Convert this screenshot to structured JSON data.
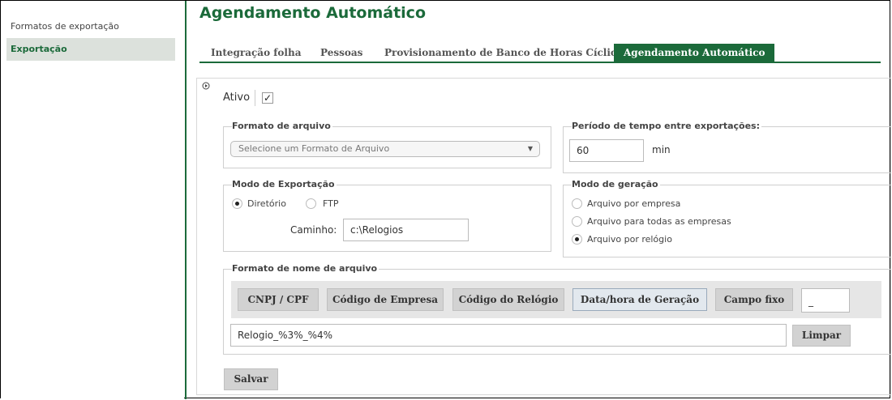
{
  "sidebar": {
    "items": [
      {
        "label": "Formatos de exportação"
      },
      {
        "label": "Exportação"
      }
    ]
  },
  "page": {
    "title": "Agendamento Automático"
  },
  "tabs": [
    {
      "label": "Integração folha"
    },
    {
      "label": "Pessoas"
    },
    {
      "label": "Provisionamento de Banco de Horas Cíclico"
    },
    {
      "label": "Agendamento Automático"
    }
  ],
  "form": {
    "ativo_label": "Ativo",
    "ativo_checked_glyph": "✓",
    "formato_arquivo": {
      "legend": "Formato de arquivo",
      "select_placeholder": "Selecione um Formato de Arquivo"
    },
    "periodo": {
      "legend": "Período de tempo entre exportações:",
      "value": "60",
      "unit": "min"
    },
    "modo_exportacao": {
      "legend": "Modo de Exportação",
      "option_diretorio": "Diretório",
      "option_ftp": "FTP",
      "caminho_label": "Caminho:",
      "caminho_value": "c:\\Relogios"
    },
    "modo_geracao": {
      "legend": "Modo de geração",
      "option_empresa": "Arquivo por empresa",
      "option_todas": "Arquivo para todas as empresas",
      "option_relogio": "Arquivo por relógio"
    },
    "nome_arquivo": {
      "legend": "Formato de nome de arquivo",
      "buttons": {
        "cnpj": "CNPJ / CPF",
        "codigo_empresa": "Código de Empresa",
        "codigo_relogio": "Código do Relógio",
        "data_hora": "Data/hora de Geração",
        "campo_fixo": "Campo fixo"
      },
      "campo_fixo_value": "_",
      "pattern_value": "Relogio_%3%_%4%",
      "limpar_label": "Limpar"
    },
    "salvar_label": "Salvar"
  },
  "colors": {
    "brand_green": "#1b6a3a"
  },
  "icons": {
    "panel_toggle": "collapse-toggle-icon",
    "select_arrow": "chevron-down-icon"
  }
}
